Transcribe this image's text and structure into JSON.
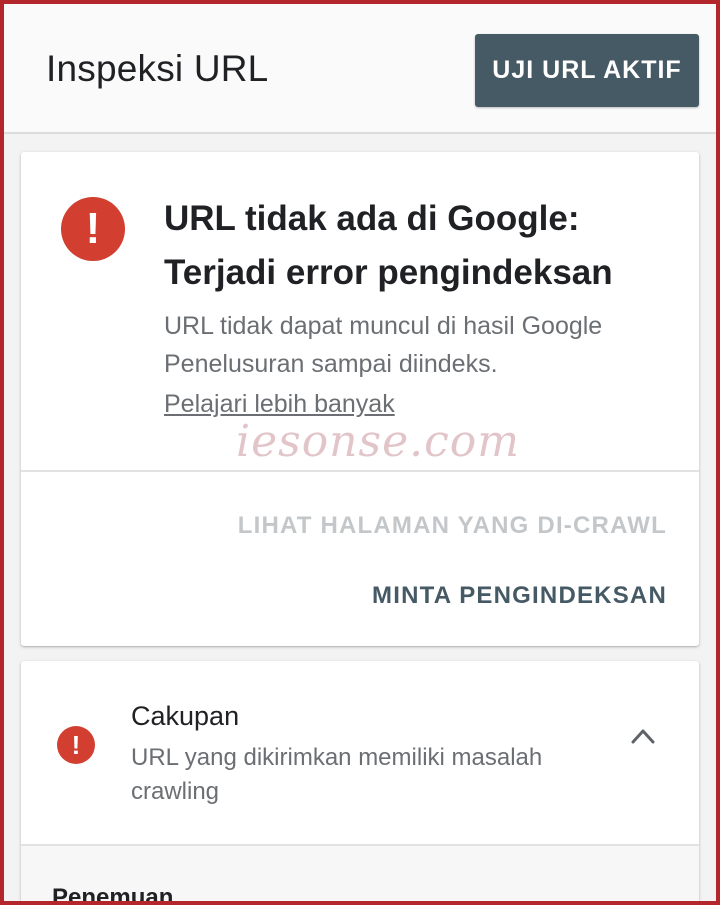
{
  "header": {
    "title": "Inspeksi URL",
    "live_test_label": "UJI URL AKTIF"
  },
  "status_card": {
    "icon": "error-exclamation-icon",
    "icon_glyph": "!",
    "icon_color": "#d23f31",
    "title": "URL tidak ada di Google: Terjadi error pengindeksan",
    "description": "URL tidak dapat muncul di hasil Google Penelusuran sampai diindeks.",
    "learn_more": "Pelajari lebih banyak",
    "view_crawled_label": "LIHAT HALAMAN YANG DI-CRAWL",
    "request_indexing_label": "MINTA PENGINDEKSAN"
  },
  "watermark": "iesonse.com",
  "coverage": {
    "icon": "error-exclamation-icon",
    "icon_glyph": "!",
    "title": "Cakupan",
    "description": "URL yang dikirimkan memiliki masalah crawling",
    "expanded_icon": "chevron-up-icon",
    "section_label": "Penemuan"
  },
  "colors": {
    "button": "#455a64",
    "error": "#d23f31",
    "frame_border": "#b3262c"
  }
}
